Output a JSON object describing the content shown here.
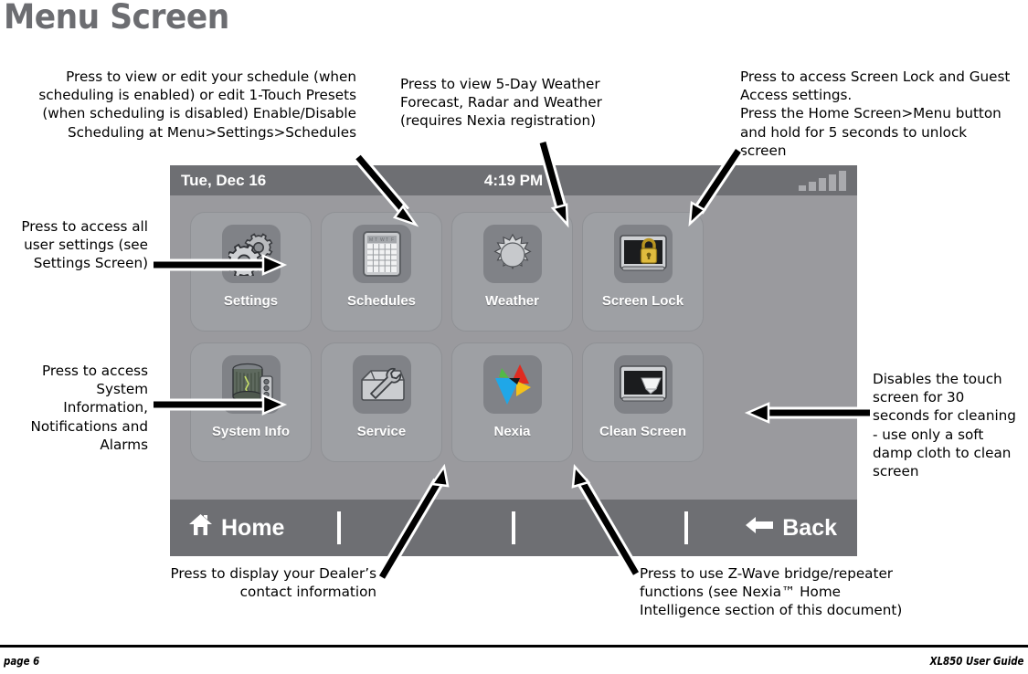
{
  "page_title": "Menu Screen",
  "callouts": {
    "schedules": "Press to view or edit your schedule (when scheduling is enabled) or edit 1-Touch Presets (when scheduling is disabled) Enable/Disable Scheduling at Menu>Settings>Schedules",
    "weather": "Press to view 5-Day Weather Forecast, Radar and Weather (requires Nexia registration)",
    "screen_lock": "Press to access Screen Lock and Guest Access settings.\nPress the Home Screen>Menu button and hold for 5 seconds to unlock screen",
    "settings": "Press to access all user settings (see Settings Screen)",
    "system_info": "Press to access System Information, Notifications and Alarms",
    "clean_screen": "Disables the touch screen for 30 seconds for cleaning - use only a soft damp cloth to clean screen",
    "service": "Press to display your Dealer’s contact information",
    "nexia": "Press to use Z-Wave bridge/repeater functions (see Nexia™ Home Intelligence section of this document)"
  },
  "device": {
    "status_bar": {
      "date": "Tue, Dec 16",
      "time": "4:19 PM",
      "signal_icon": "signal-bars-icon",
      "signal_bars": 5,
      "background_color": "#6e6f73"
    },
    "screen_background_color": "#9a9a9e",
    "tiles": [
      {
        "label": "Settings",
        "icon": "gears-icon"
      },
      {
        "label": "Schedules",
        "icon": "calendar-icon"
      },
      {
        "label": "Weather",
        "icon": "sun-icon"
      },
      {
        "label": "Screen Lock",
        "icon": "screen-lock-icon"
      },
      {
        "label": "System Info",
        "icon": "hvac-unit-icon"
      },
      {
        "label": "Service",
        "icon": "toolbox-wrench-icon"
      },
      {
        "label": "Nexia",
        "icon": "nexia-logo-icon"
      },
      {
        "label": "Clean Screen",
        "icon": "screen-cloth-icon"
      }
    ],
    "bottom_bar": {
      "home_label": "Home",
      "home_icon": "house-icon",
      "back_label": "Back",
      "back_icon": "left-arrow-icon",
      "background_color": "#6e6f73"
    }
  },
  "footer": {
    "left": "page 6",
    "right": "XL850 User Guide"
  },
  "colors": {
    "title_gray": "#6c6d71",
    "bar_gray": "#6e6f73",
    "screen_gray": "#9a9a9e",
    "tile_gray": "#9ea0a4",
    "icon_plate_gray": "#808287",
    "lock_gold": "#d6b23a",
    "nexia_blue": "#1fa7e8",
    "nexia_red": "#e02b20",
    "nexia_yellow": "#f5c21a",
    "nexia_green": "#53b948"
  }
}
